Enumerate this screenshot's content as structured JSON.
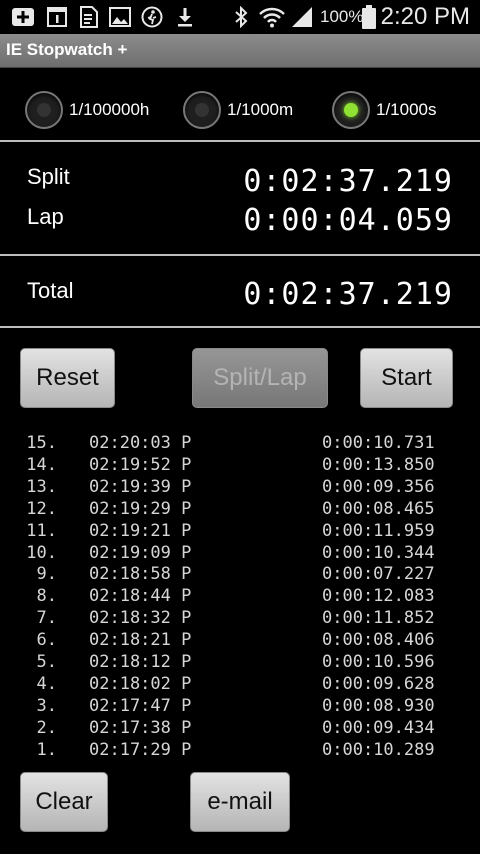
{
  "status_bar": {
    "icons": [
      "add-box-icon",
      "calendar-icon",
      "document-icon",
      "image-icon",
      "running-person-icon",
      "download-icon",
      "bluetooth-icon",
      "wifi-icon",
      "signal-icon",
      "battery-icon"
    ],
    "battery": "100%",
    "time": "2:20 PM"
  },
  "app": {
    "title": "IE Stopwatch +"
  },
  "resolution": {
    "options": [
      {
        "label": "1/100000h",
        "selected": false
      },
      {
        "label": "1/1000m",
        "selected": false
      },
      {
        "label": "1/1000s",
        "selected": true
      }
    ]
  },
  "times": {
    "split_label": "Split",
    "split_value": "0:02:37.219",
    "lap_label": "Lap",
    "lap_value": "0:00:04.059",
    "total_label": "Total",
    "total_value": "0:02:37.219"
  },
  "buttons": {
    "reset": "Reset",
    "split_lap": "Split/Lap",
    "start": "Start",
    "clear": "Clear",
    "email": "e-mail"
  },
  "laps": [
    {
      "num": "15.",
      "time": "02:20:03 P",
      "elapsed": "0:00:10.731"
    },
    {
      "num": "14.",
      "time": "02:19:52 P",
      "elapsed": "0:00:13.850"
    },
    {
      "num": "13.",
      "time": "02:19:39 P",
      "elapsed": "0:00:09.356"
    },
    {
      "num": "12.",
      "time": "02:19:29 P",
      "elapsed": "0:00:08.465"
    },
    {
      "num": "11.",
      "time": "02:19:21 P",
      "elapsed": "0:00:11.959"
    },
    {
      "num": "10.",
      "time": "02:19:09 P",
      "elapsed": "0:00:10.344"
    },
    {
      "num": "9.",
      "time": "02:18:58 P",
      "elapsed": "0:00:07.227"
    },
    {
      "num": "8.",
      "time": "02:18:44 P",
      "elapsed": "0:00:12.083"
    },
    {
      "num": "7.",
      "time": "02:18:32 P",
      "elapsed": "0:00:11.852"
    },
    {
      "num": "6.",
      "time": "02:18:21 P",
      "elapsed": "0:00:08.406"
    },
    {
      "num": "5.",
      "time": "02:18:12 P",
      "elapsed": "0:00:10.596"
    },
    {
      "num": "4.",
      "time": "02:18:02 P",
      "elapsed": "0:00:09.628"
    },
    {
      "num": "3.",
      "time": "02:17:47 P",
      "elapsed": "0:00:08.930"
    },
    {
      "num": "2.",
      "time": "02:17:38 P",
      "elapsed": "0:00:09.434"
    },
    {
      "num": "1.",
      "time": "02:17:29 P",
      "elapsed": "0:00:10.289"
    }
  ]
}
